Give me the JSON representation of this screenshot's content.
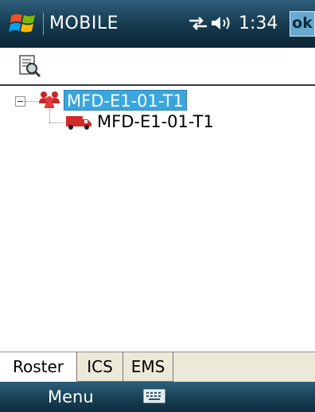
{
  "title_bar": {
    "app_title": "MOBILE",
    "time": "1:34",
    "ok_label": "ok",
    "icons": [
      "windows-start-icon",
      "connectivity-icon",
      "volume-icon"
    ]
  },
  "toolbar": {
    "icons": [
      "find-icon"
    ]
  },
  "tree": {
    "root": {
      "label": "MFD-E1-01-T1",
      "icon": "group-icon",
      "expanded": true,
      "selected": true
    },
    "children": [
      {
        "label": "MFD-E1-01-T1",
        "icon": "truck-icon"
      }
    ]
  },
  "tabs": [
    {
      "label": "Roster",
      "active": true
    },
    {
      "label": "ICS",
      "active": false
    },
    {
      "label": "EMS",
      "active": false
    }
  ],
  "soft_keys": {
    "left": "Menu",
    "center_icon": "keyboard-icon"
  },
  "colors": {
    "title_bar": "#15384d",
    "selection": "#3aa6dd",
    "truck": "#d12b2b"
  }
}
